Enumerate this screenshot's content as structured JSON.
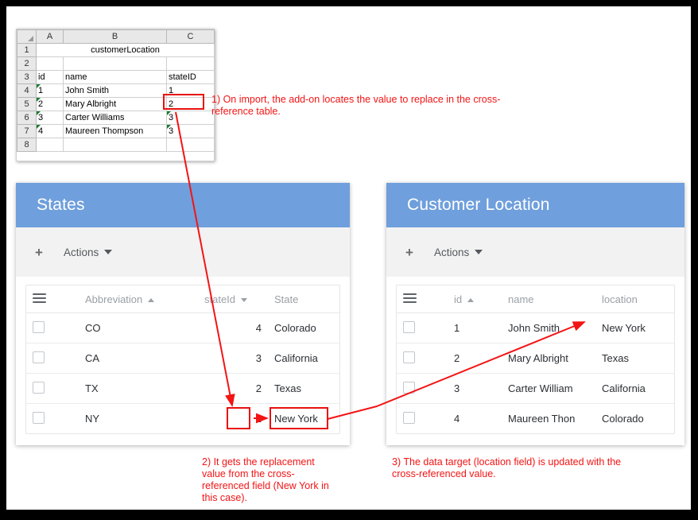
{
  "spreadsheet": {
    "name": "customerLocation",
    "column_headers": [
      "A",
      "B",
      "C"
    ],
    "row_numbers": [
      "1",
      "2",
      "3",
      "4",
      "5",
      "6",
      "7",
      "8"
    ],
    "title_cell": "customerLocation",
    "field_headers": {
      "id": "id",
      "name": "name",
      "stateID": "stateID"
    },
    "rows": [
      {
        "id": "1",
        "name": "John Smith",
        "stateID": "1",
        "id_flag": true,
        "state_flag": false
      },
      {
        "id": "2",
        "name": "Mary Albright",
        "stateID": "2",
        "id_flag": true,
        "state_flag": false
      },
      {
        "id": "3",
        "name": "Carter Williams",
        "stateID": "3",
        "id_flag": true,
        "state_flag": true
      },
      {
        "id": "4",
        "name": "Maureen Thompson",
        "stateID": "3",
        "id_flag": true,
        "state_flag": true
      }
    ]
  },
  "states_panel": {
    "title": "States",
    "toolbar": {
      "add_label": "+",
      "actions_label": "Actions"
    },
    "columns": [
      {
        "key": "checkbox",
        "label": ""
      },
      {
        "key": "abbreviation",
        "label": "Abbreviation",
        "sort": "asc"
      },
      {
        "key": "stateId",
        "label": "stateId",
        "sort": "desc"
      },
      {
        "key": "state",
        "label": "State",
        "sort": "none"
      }
    ],
    "rows": [
      {
        "abbreviation": "CO",
        "stateId": "4",
        "state": "Colorado"
      },
      {
        "abbreviation": "CA",
        "stateId": "3",
        "state": "California"
      },
      {
        "abbreviation": "TX",
        "stateId": "2",
        "state": "Texas"
      },
      {
        "abbreviation": "NY",
        "stateId": "1",
        "state": "New York"
      }
    ]
  },
  "customer_panel": {
    "title": "Customer Location",
    "toolbar": {
      "add_label": "+",
      "actions_label": "Actions"
    },
    "columns": [
      {
        "key": "checkbox",
        "label": ""
      },
      {
        "key": "id",
        "label": "id",
        "sort": "asc"
      },
      {
        "key": "name",
        "label": "name",
        "sort": "none"
      },
      {
        "key": "location",
        "label": "location",
        "sort": "none"
      }
    ],
    "rows": [
      {
        "id": "1",
        "name": "John Smith",
        "location": "New York"
      },
      {
        "id": "2",
        "name": "Mary Albright",
        "location": "Texas"
      },
      {
        "id": "3",
        "name": "Carter William",
        "location": "California"
      },
      {
        "id": "4",
        "name": "Maureen Thon",
        "location": "Colorado"
      }
    ]
  },
  "annotations": {
    "note1": "1) On import, the add-on locates the value to replace in the cross-reference table.",
    "note2": "2) It gets the replacement value from the cross-referenced field (New York in this case).",
    "note3": "3) The data target (location field) is updated with the cross-referenced value."
  },
  "colors": {
    "panel_header_blue": "#6f9fdc",
    "annotation_red": "#f31414",
    "highlight_box_red": "#e8110f",
    "toolbar_grey": "#f2f2f2",
    "frame_black": "#000000"
  }
}
